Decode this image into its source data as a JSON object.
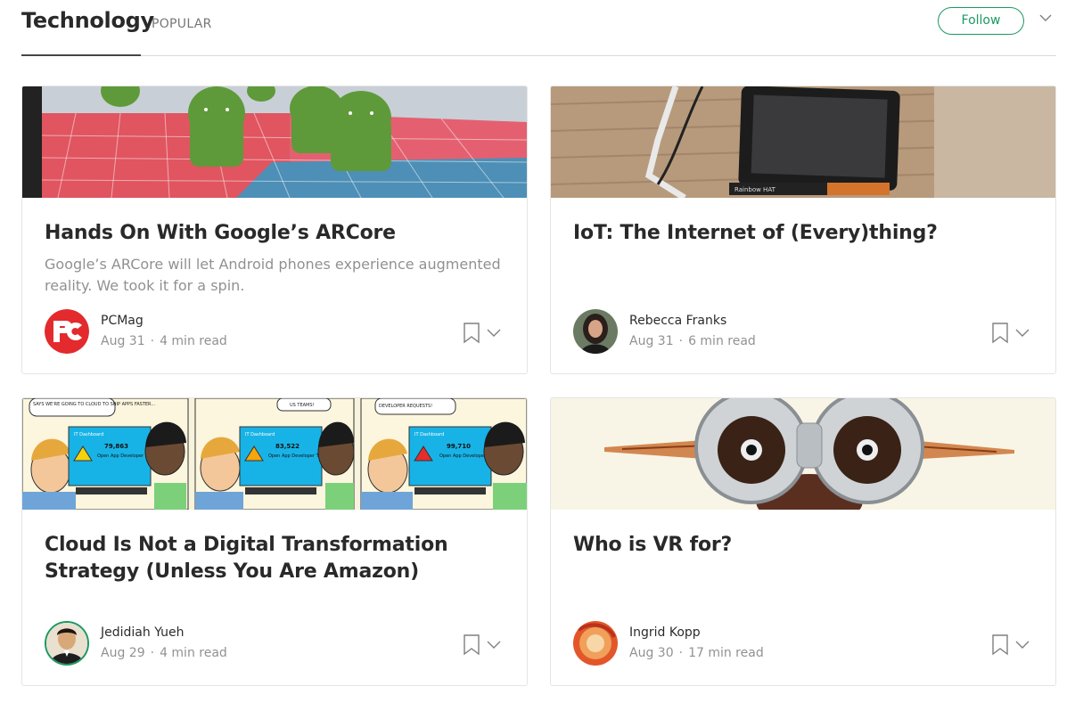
{
  "header": {
    "title": "Technology",
    "subtitle": "POPULAR",
    "follow_label": "Follow"
  },
  "posts": [
    {
      "title": "Hands On With Google’s ARCore",
      "description": "Google’s ARCore will let Android phones experience augmented reality. We took it for a spin.",
      "author": "PCMag",
      "date": "Aug 31",
      "read_time": "4 min read",
      "image": "android-robots-ar-image",
      "avatar": "pcmag-logo"
    },
    {
      "title": "IoT: The Internet of (Every)thing?",
      "description": "",
      "author": "Rebecca Franks",
      "date": "Aug 31",
      "read_time": "6 min read",
      "image": "raspberry-pi-display-image",
      "avatar": "rebecca-franks-photo"
    },
    {
      "title": "Cloud Is Not a Digital Transformation Strategy (Unless You Are Amazon)",
      "description": "",
      "author": "Jedidiah Yueh",
      "date": "Aug 29",
      "read_time": "4 min read",
      "image": "it-dashboard-comic-image",
      "avatar": "jedidiah-yueh-photo",
      "comic_panels": [
        {
          "bubble": "SAYS WE'RE GOING TO CLOUD TO SHIP APPS FASTER...",
          "dash_title": "IT Dashboard",
          "count": "79,863",
          "label": "Open App Developer Tickets"
        },
        {
          "bubble": "US TEAMS!",
          "dash_title": "IT Dashboard",
          "count": "83,522",
          "label": "Open App Developer Tickets"
        },
        {
          "bubble": "DEVELOPER REQUESTS!",
          "dash_title": "IT Dashboard",
          "count": "99,710",
          "label": "Open App Developer Tickets"
        }
      ]
    },
    {
      "title": "Who is VR for?",
      "description": "",
      "author": "Ingrid Kopp",
      "date": "Aug 30",
      "read_time": "17 min read",
      "image": "vr-goggles-image",
      "avatar": "ingrid-kopp-photo"
    }
  ],
  "colors": {
    "accent": "#1c9963",
    "text": "#292929",
    "muted": "#8f8f8f"
  }
}
